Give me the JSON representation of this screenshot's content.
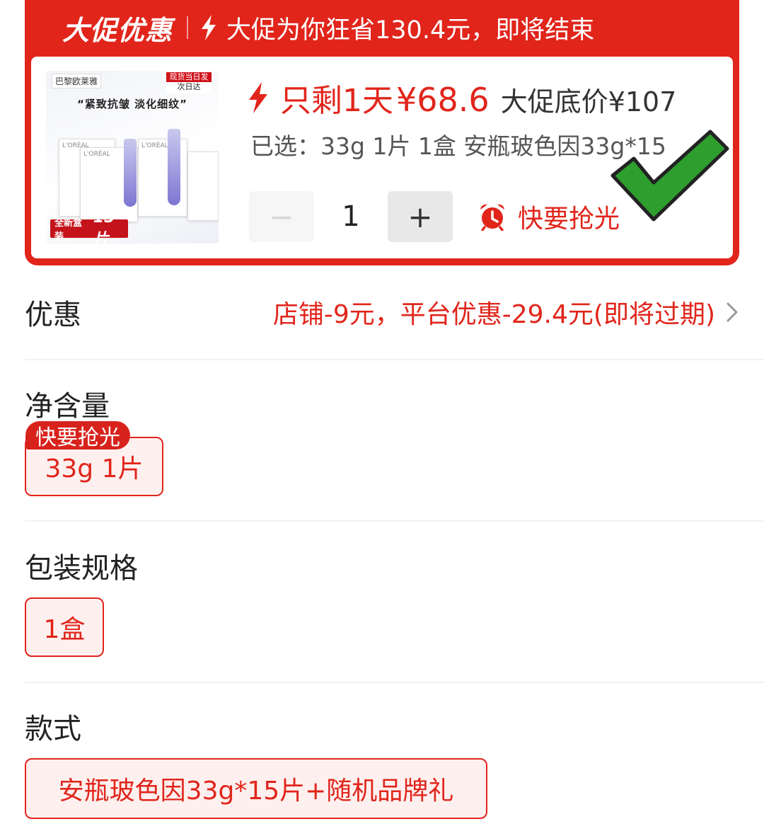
{
  "promo": {
    "logo": "大促优惠",
    "saving_text": "大促为你狂省130.4元，即将结束"
  },
  "product": {
    "thumb": {
      "brand": "巴黎欧莱雅",
      "stock_line1": "现货当日发",
      "stock_line2": "次日达",
      "slogan": "“紧致抗皱 淡化细纹”",
      "box_label": "L'ORÉAL",
      "bottom_label": "全新盒装",
      "bottom_count": "15片"
    },
    "countdown": "只剩1天",
    "price": "¥68.6",
    "bottom_price": "大促底价¥107",
    "selected": "已选：33g 1片 1盒 安瓶玻色因33g*15",
    "quantity": "1",
    "minus_label": "−",
    "plus_label": "+",
    "urgency": "快要抢光"
  },
  "discount": {
    "label": "优惠",
    "value": "店铺-9元，平台优惠-29.4元(即将过期)"
  },
  "sections": {
    "net_content": {
      "label": "净含量",
      "badge": "快要抢光",
      "option": "33g 1片"
    },
    "packaging": {
      "label": "包装规格",
      "option": "1盒"
    },
    "style": {
      "label": "款式",
      "option": "安瓶玻色因33g*15片+随机品牌礼"
    }
  },
  "colors": {
    "accent": "#e1251b",
    "check": "#2e9e2e"
  },
  "icons": [
    "bolt-icon",
    "alarm-clock-icon",
    "check-icon",
    "chevron-right-icon"
  ]
}
